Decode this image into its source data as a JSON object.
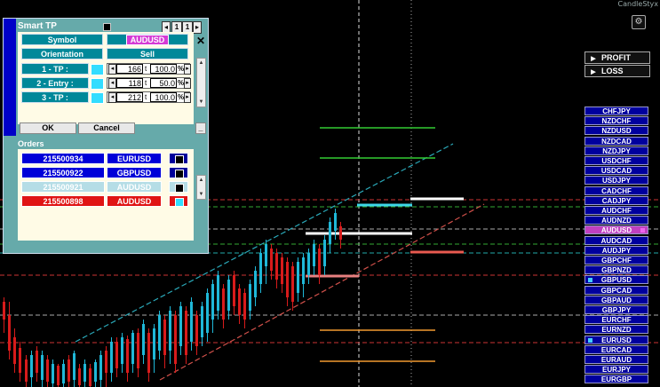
{
  "brand": "CandleStyx",
  "colors": {
    "bull": "#1fb8d8",
    "bear": "#d81b1b",
    "channel_up": "#2aa8b8",
    "channel_down": "#d0504a",
    "panel_bg": "#66aaaa",
    "tp_green": "#3c3",
    "orange": "#f39a30"
  },
  "panel": {
    "title": "Smart TP",
    "page_from": "1",
    "page_to": "1",
    "symbol_label": "Symbol",
    "symbol_value": "AUDUSD",
    "orientation_label": "Orientation",
    "orientation_value": "Sell",
    "rows": [
      {
        "label": "1 - TP :",
        "value": "166",
        "pct": "100.0"
      },
      {
        "label": "2 - Entry :",
        "value": "118",
        "pct": "50.0"
      },
      {
        "label": "3 - TP :",
        "value": "212",
        "pct": "100.0"
      }
    ],
    "step_glyph": "t",
    "pct_suffix": "%",
    "ok_label": "OK",
    "cancel_label": "Cancel",
    "orders_title": "Orders",
    "orders": [
      {
        "id": "215500934",
        "symbol": "EURUSD",
        "state": "blue"
      },
      {
        "id": "215500922",
        "symbol": "GBPUSD",
        "state": "blue"
      },
      {
        "id": "215500921",
        "symbol": "AUDUSD",
        "state": "light"
      },
      {
        "id": "215500898",
        "symbol": "AUDUSD",
        "state": "red"
      }
    ]
  },
  "profit_label": "PROFIT",
  "loss_label": "LOSS",
  "symbols": [
    "CHFJPY",
    "NZDCHF",
    "NZDUSD",
    "NZDCAD",
    "NZDJPY",
    "USDCHF",
    "USDCAD",
    "USDJPY",
    "CADCHF",
    "CADJPY",
    "AUDCHF",
    "AUDNZD",
    "AUDUSD",
    "AUDCAD",
    "AUDJPY",
    "GBPCHF",
    "GBPNZD",
    "GBPUSD",
    "GBPCAD",
    "GBPAUD",
    "GBPJPY",
    "EURCHF",
    "EURNZD",
    "EURUSD",
    "EURCAD",
    "EURAUD",
    "EURJPY",
    "EURGBP"
  ],
  "selected_symbol": "AUDUSD",
  "dotted_symbols": [
    "GBPUSD",
    "EURUSD"
  ]
}
